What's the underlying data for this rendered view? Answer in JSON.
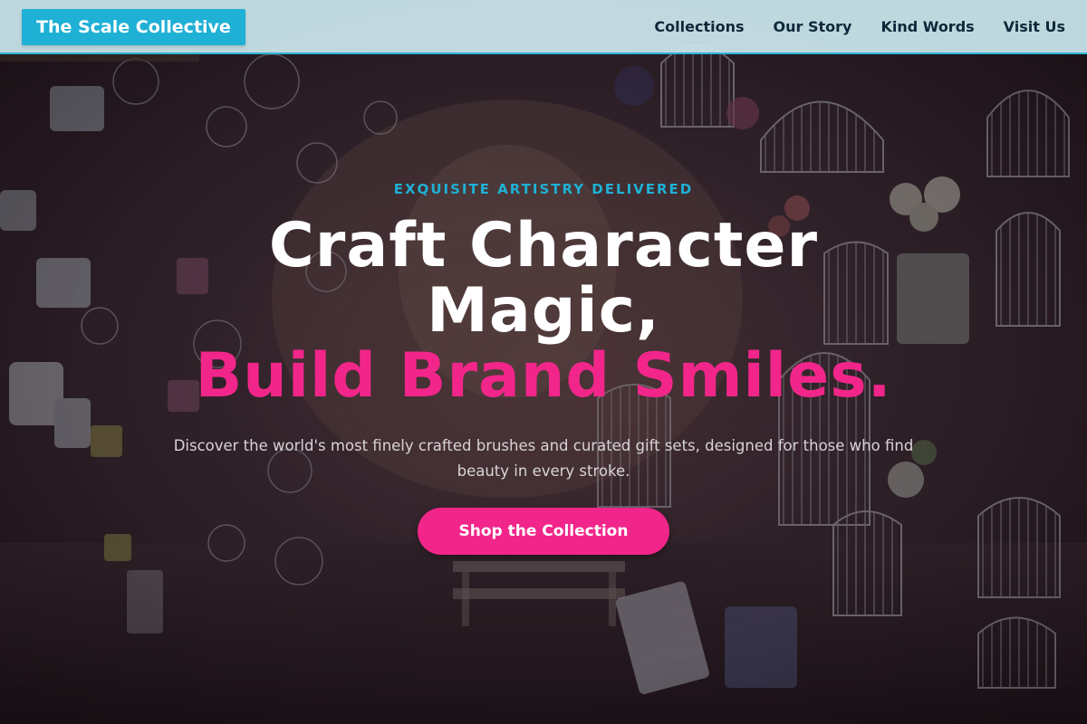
{
  "header": {
    "logo_text": "The Scale Collective",
    "nav": [
      {
        "label": "Collections"
      },
      {
        "label": "Our Story"
      },
      {
        "label": "Kind Words"
      },
      {
        "label": "Visit Us"
      }
    ]
  },
  "hero": {
    "eyebrow": "EXQUISITE ARTISTRY DELIVERED",
    "headline_line1": "Craft Character",
    "headline_line2": "Magic,",
    "headline_accent": "Build Brand Smiles.",
    "subtitle": "Discover the world's most finely crafted brushes and curated gift sets, designed for those who find beauty in every stroke.",
    "cta_label": "Shop the Collection"
  },
  "colors": {
    "accent_cyan": "#1fb0d5",
    "accent_pink": "#f2268a",
    "header_bg": "#cde9f0",
    "nav_text": "#10273a"
  }
}
